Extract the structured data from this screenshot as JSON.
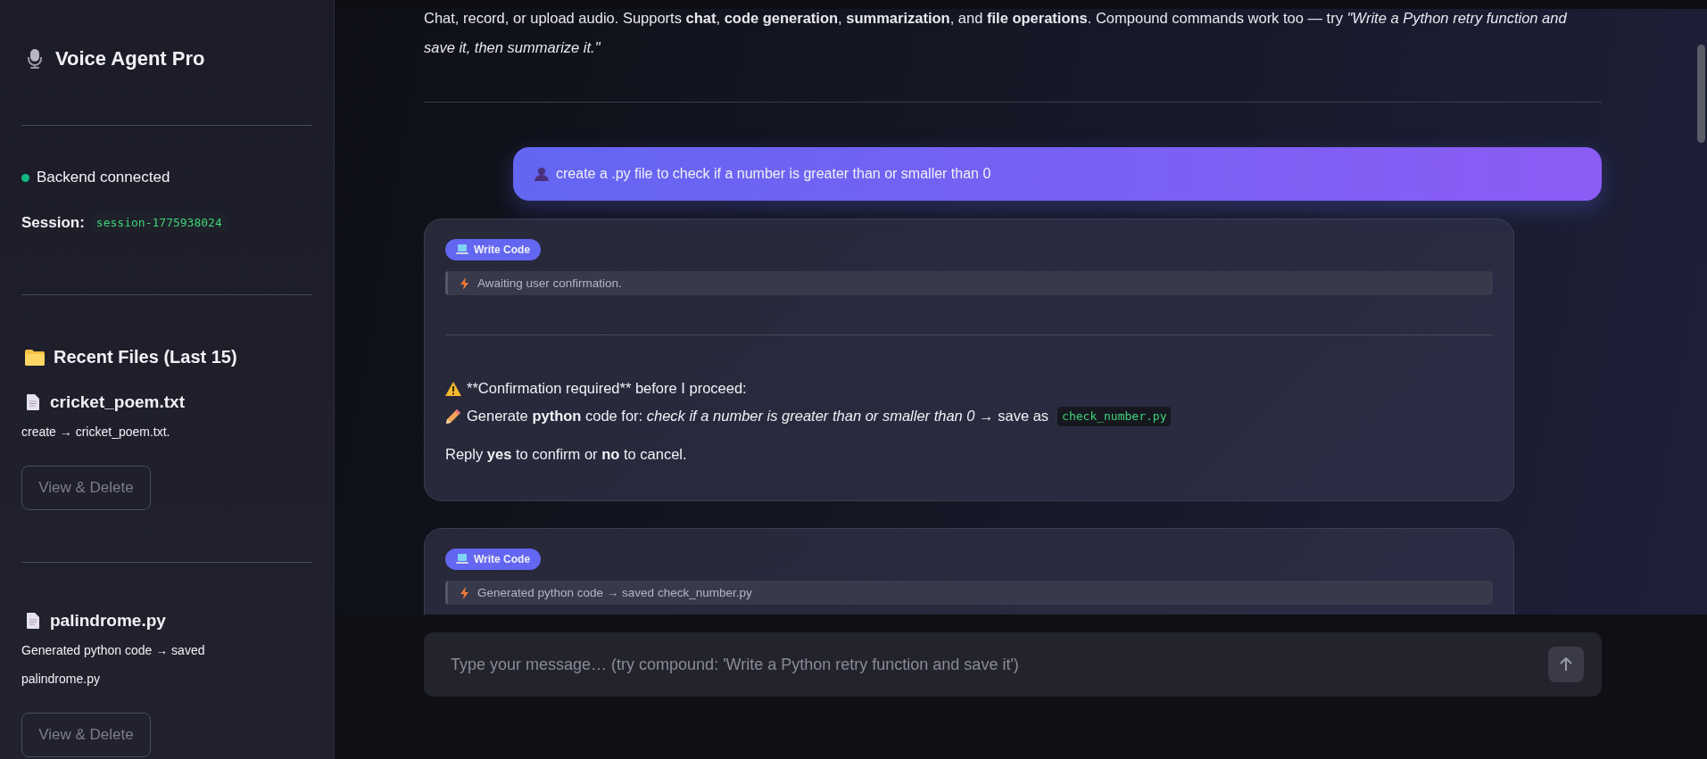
{
  "sidebar": {
    "title": "Voice Agent Pro",
    "status": {
      "text": "Backend connected",
      "color": "#10b981"
    },
    "session": {
      "label": "Session:",
      "value": "session-1775938024"
    },
    "recent_files": {
      "title": "Recent Files (Last 15)",
      "files": [
        {
          "name": "cricket_poem.txt",
          "lines": [
            "create → cricket_poem.txt."
          ],
          "button": "View & Delete"
        },
        {
          "name": "palindrome.py",
          "lines": [
            "Generated python code → saved",
            "palindrome.py"
          ],
          "button": "View & Delete"
        }
      ]
    }
  },
  "intro": "Chat, record, or upload audio. Supports **chat**, **code generation**, **summarization**, and **file operations**. Compound commands work too — try *\"Write a Python retry function and save it, then summarize it.\"*",
  "messages": [
    {
      "kind": "user",
      "text": "create a .py file to check if a number is greater than or smaller than 0"
    },
    {
      "kind": "agent",
      "badge": "Write Code",
      "status": "Awaiting user confirmation.",
      "body": [
        {
          "kind": "warning",
          "text": "**Confirmation required** before I proceed:"
        },
        {
          "kind": "pencil",
          "text": "Generate **python** code for: *check if a number is greater than or smaller than 0* → save as",
          "code": "check_number.py"
        },
        {
          "kind": "plain",
          "text": "Reply **yes** to confirm or **no** to cancel."
        }
      ]
    },
    {
      "kind": "agent",
      "badge": "Write Code",
      "status": "Generated python code → saved check_number.py"
    }
  ],
  "input": {
    "placeholder": "Type your message… (try compound: 'Write a Python retry function and save it')"
  }
}
